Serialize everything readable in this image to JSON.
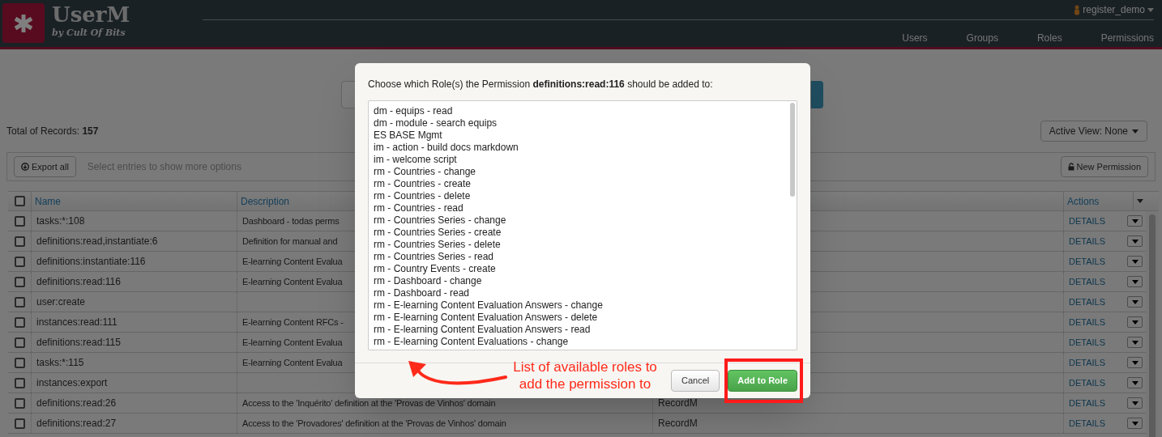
{
  "header": {
    "logo": {
      "title": "UserM",
      "subtitle": "by Cult Of Bits"
    },
    "user": "register_demo",
    "nav": [
      "Users",
      "Groups",
      "Roles",
      "Permissions"
    ]
  },
  "toolbar": {
    "total_label": "Total of Records:",
    "total": "157",
    "active_view": "Active View: None",
    "export": "Export all",
    "hint": "Select entries to show more options",
    "new_button": "New Permission"
  },
  "table": {
    "select_all_checked": false,
    "columns": [
      "Name",
      "Description",
      "Actions"
    ],
    "rows": [
      {
        "checked": false,
        "name": "tasks:*:108",
        "description": "Dashboard - todas perms",
        "action": "DETAILS"
      },
      {
        "checked": false,
        "name": "definitions:read,instantiate:6",
        "description": "Definition for manual and",
        "action": "DETAILS"
      },
      {
        "checked": false,
        "name": "definitions:instantiate:116",
        "description": "E-learning Content Evalua",
        "action": "DETAILS"
      },
      {
        "checked": false,
        "name": "definitions:read:116",
        "description": "E-learning Content Evalua",
        "action": "DETAILS"
      },
      {
        "checked": false,
        "name": "user:create",
        "action": "DETAILS"
      },
      {
        "checked": false,
        "name": "instances:read:111",
        "description": "E-learning Content RFCs -",
        "action": "DETAILS"
      },
      {
        "checked": false,
        "name": "definitions:read:115",
        "description": "E-learning Content Evalua",
        "action": "DETAILS"
      },
      {
        "checked": false,
        "name": "tasks:*:115",
        "description": "E-learning Content Evalua",
        "action": "DETAILS"
      },
      {
        "checked": false,
        "name": "instances:export",
        "action": "DETAILS"
      },
      {
        "checked": false,
        "name": "definitions:read:26",
        "description": "Access to the 'Inquérito' definition at the 'Provas de Vinhos' domain",
        "column_3": "RecordM",
        "action": "DETAILS"
      },
      {
        "checked": false,
        "name": "definitions:read:27",
        "description": "Access to the 'Provadores' definition at the 'Provas de Vinhos' domain",
        "column_3": "RecordM",
        "action": "DETAILS"
      }
    ]
  },
  "modal": {
    "prompt": "Choose which Role(s) the Permission **definitions:read:116** should be added to:",
    "roles": [
      "dm - equips - read",
      "dm - module - search equips",
      "ES BASE Mgmt",
      "im - action - build docs markdown",
      "im - welcome script",
      "rm - Countries - change",
      "rm - Countries - create",
      "rm - Countries - delete",
      "rm - Countries - read",
      "rm - Countries Series - change",
      "rm - Countries Series - create",
      "rm - Countries Series - delete",
      "rm - Countries Series - read",
      "rm - Country Events - create",
      "rm - Dashboard - change",
      "rm - Dashboard - read",
      "rm - E-learning Content Evaluation Answers - change",
      "rm - E-learning Content Evaluation Answers - delete",
      "rm - E-learning Content Evaluation Answers - read",
      "rm - E-learning Content Evaluations - change"
    ],
    "cancel": "Cancel",
    "confirm": "Add to Role"
  },
  "annotation": {
    "text": "List of available roles to add the permission to"
  }
}
